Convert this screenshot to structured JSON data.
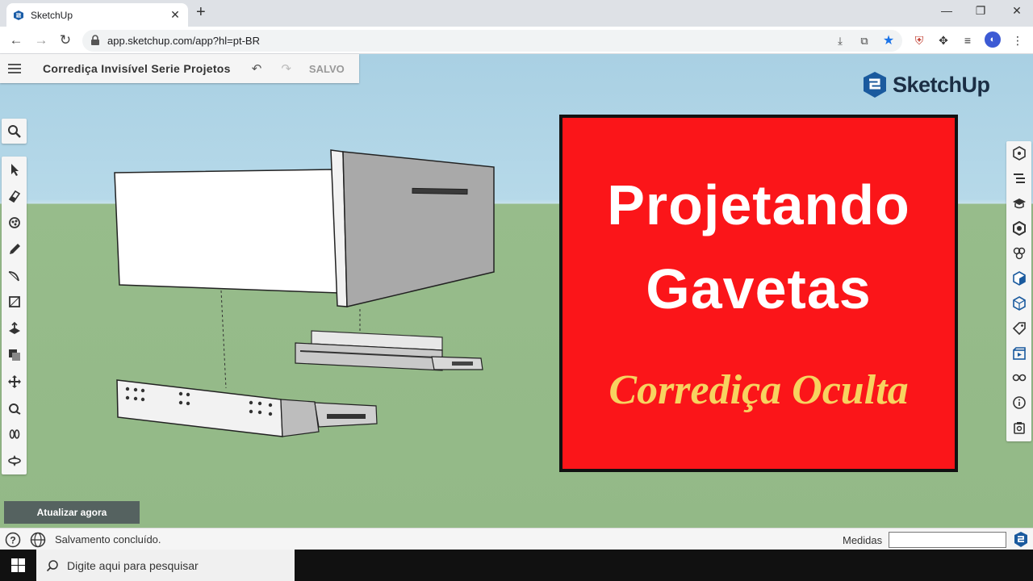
{
  "browser": {
    "tab_title": "SketchUp",
    "url": "app.sketchup.com/app?hl=pt-BR"
  },
  "app": {
    "menu_icon": "hamburger-menu-icon",
    "model_title": "Corrediça Invisível Serie Projetos",
    "save_status": "SALVO",
    "logo_text": "SketchUp"
  },
  "banner": {
    "line1": "Projetando",
    "line2": "Gavetas",
    "subtitle": "Corrediça Oculta",
    "colors": {
      "background": "#fb1519",
      "title": "#ffffff",
      "subtitle": "#f7d360"
    }
  },
  "left_toolbar": [
    "select-icon",
    "eraser-icon",
    "paint-bucket-icon",
    "pencil-icon",
    "arc-icon",
    "rectangle-icon",
    "push-pull-icon",
    "offset-icon",
    "move-icon",
    "tape-measure-icon",
    "walk-icon",
    "orbit-icon"
  ],
  "right_panel": [
    "entity-info-icon",
    "outliner-icon",
    "instructor-icon",
    "components-icon",
    "materials-icon",
    "styles-icon",
    "tags-icon",
    "scenes-icon",
    "display-icon",
    "about-icon",
    "solid-inspector-icon"
  ],
  "update_button": "Atualizar agora",
  "status": {
    "message": "Salvamento concluído.",
    "measures_label": "Medidas",
    "measures_value": ""
  },
  "taskbar": {
    "search_placeholder": "Digite aqui para pesquisar"
  }
}
